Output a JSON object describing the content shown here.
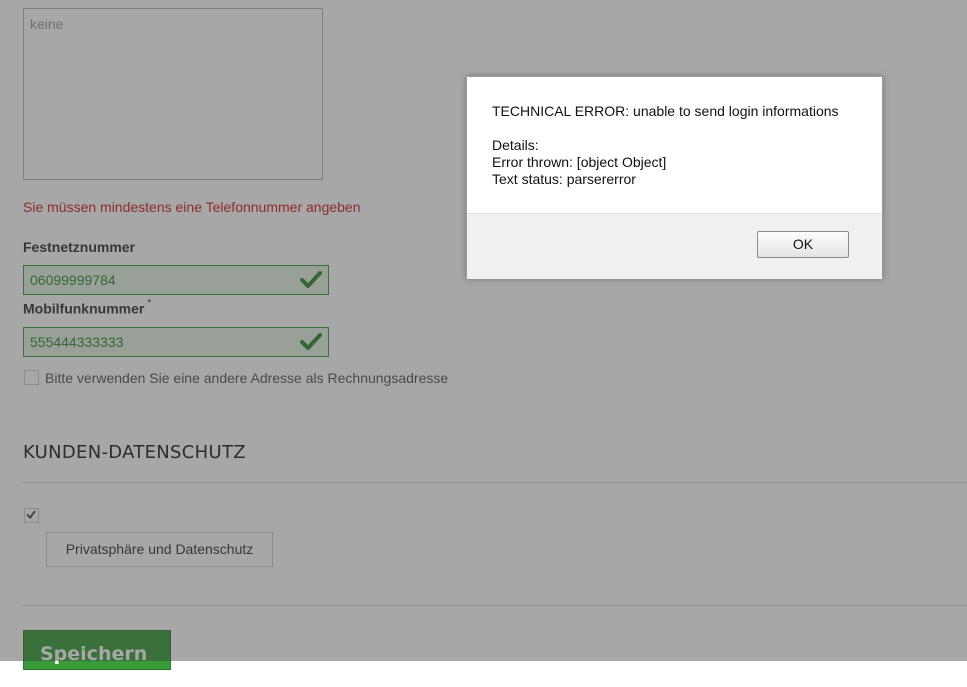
{
  "form": {
    "textarea_placeholder": "keine",
    "phone_error": "Sie müssen mindestens eine Telefonnummer angeben",
    "landline_label": "Festnetznummer",
    "landline_value": "06099999784",
    "mobile_label": "Mobilfunknummer",
    "required_marker": "*",
    "mobile_value": "555444333333",
    "alt_address_label": "Bitte verwenden Sie eine andere Adresse als Rechnungsadresse",
    "privacy_section_title": "KUNDEN-DATENSCHUTZ",
    "privacy_button_label": "Privatsphäre und Datenschutz",
    "save_label": "Speichern",
    "save_chevron": "›"
  },
  "dialog": {
    "error_title": "TECHNICAL ERROR: unable to send login informations",
    "details_label": "Details:",
    "error_thrown": "Error thrown: [object Object]",
    "text_status": "Text status: parsererror",
    "ok_label": "OK"
  },
  "colors": {
    "error_red": "#d21f1f",
    "valid_green": "#3aa13a",
    "save_green": "#3a9b3a"
  },
  "icons": {
    "valid": "check-icon",
    "privacy_checkbox": "checkmark-icon",
    "save": "chevron-right-icon"
  }
}
